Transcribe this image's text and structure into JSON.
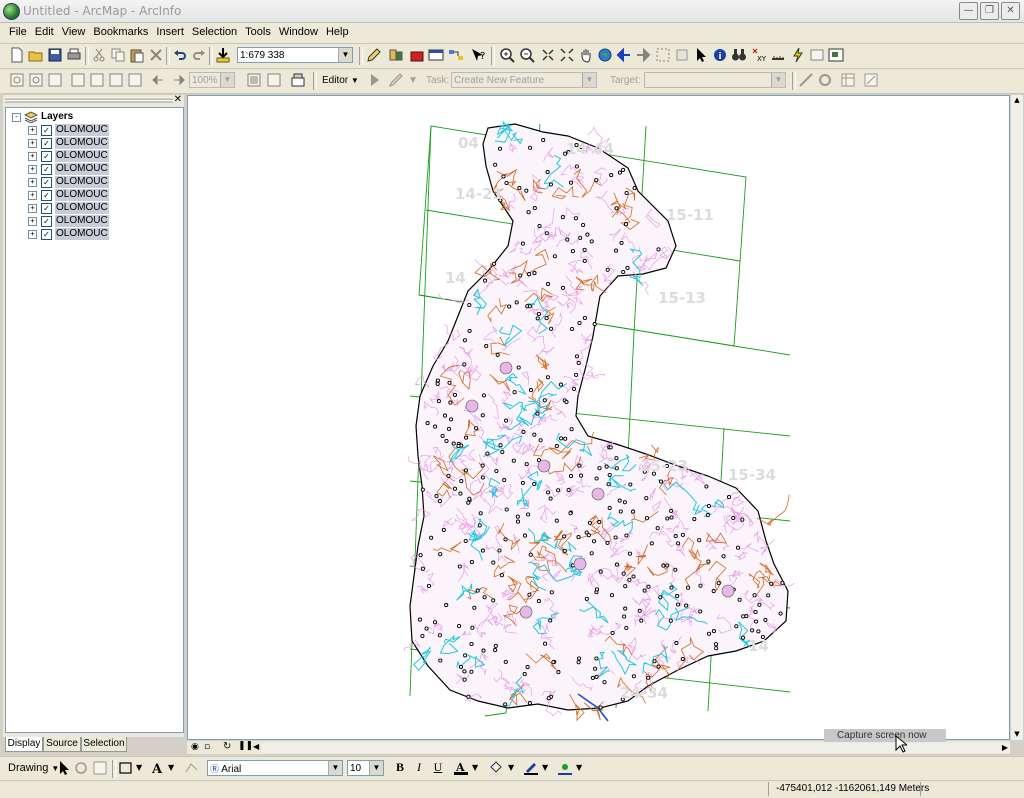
{
  "window": {
    "title": "Untitled - ArcMap - ArcInfo"
  },
  "menu": [
    "File",
    "Edit",
    "View",
    "Bookmarks",
    "Insert",
    "Selection",
    "Tools",
    "Window",
    "Help"
  ],
  "toolbar": {
    "scale": "1:679 338",
    "zoom": "100%",
    "editor_label": "Editor",
    "task_label": "Task:",
    "task_value": "Create New Feature",
    "target_label": "Target:",
    "target_value": ""
  },
  "toc": {
    "root": "Layers",
    "layers": [
      "OLOMOUC",
      "OLOMOUC",
      "OLOMOUC",
      "OLOMOUC",
      "OLOMOUC",
      "OLOMOUC",
      "OLOMOUC",
      "OLOMOUC",
      "OLOMOUC"
    ],
    "tabs": [
      "Display",
      "Source",
      "Selection"
    ]
  },
  "map": {
    "sheet_labels": [
      "04",
      "14-44",
      "14-21",
      "15-11",
      "14",
      "15-13",
      "15-23",
      "15-34",
      "14",
      "24-34"
    ],
    "colors": {
      "boundary": "#000000",
      "grid": "#1a9e1a",
      "rivers": "#22c8e0",
      "municipalities": "#e89ee8",
      "roads": "#d2691e"
    }
  },
  "capture_label": "Capture screen now",
  "drawing": {
    "label": "Drawing",
    "font": "Arial",
    "size": "10"
  },
  "status": {
    "coordinates": "-475401,012  -1162061,149 Meters"
  }
}
